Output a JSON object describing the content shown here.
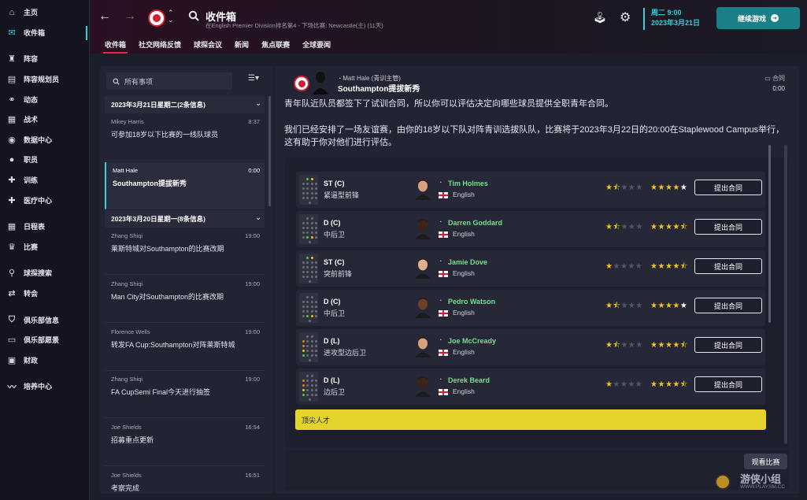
{
  "sidebar": {
    "items": [
      {
        "label": "主页",
        "icon": "home-icon",
        "glyph": "⌂"
      },
      {
        "label": "收件箱",
        "icon": "inbox-icon",
        "glyph": "✉",
        "active": true
      },
      {
        "label": "阵容",
        "icon": "shirt-icon",
        "glyph": "♜"
      },
      {
        "label": "阵容规划员",
        "icon": "clipboard-icon",
        "glyph": "▤"
      },
      {
        "label": "动态",
        "icon": "dynamics-icon",
        "glyph": "⚭"
      },
      {
        "label": "战术",
        "icon": "tactics-icon",
        "glyph": "▦"
      },
      {
        "label": "数据中心",
        "icon": "data-hub-icon",
        "glyph": "◉"
      },
      {
        "label": "职员",
        "icon": "staff-icon",
        "glyph": "●"
      },
      {
        "label": "训练",
        "icon": "training-icon",
        "glyph": "✚"
      },
      {
        "label": "医疗中心",
        "icon": "medical-icon",
        "glyph": "✚"
      },
      {
        "label": "日程表",
        "icon": "calendar-icon",
        "glyph": "▦"
      },
      {
        "label": "比赛",
        "icon": "trophy-icon",
        "glyph": "♛"
      },
      {
        "label": "球探搜索",
        "icon": "scouting-icon",
        "glyph": "⚲"
      },
      {
        "label": "转会",
        "icon": "transfer-icon",
        "glyph": "⇄"
      },
      {
        "label": "俱乐部信息",
        "icon": "club-info-icon",
        "glyph": "⛉"
      },
      {
        "label": "俱乐部愿景",
        "icon": "club-vision-icon",
        "glyph": "▭"
      },
      {
        "label": "财政",
        "icon": "finance-icon",
        "glyph": "▣"
      },
      {
        "label": "培养中心",
        "icon": "development-icon",
        "glyph": "〰"
      }
    ]
  },
  "header": {
    "title": "收件箱",
    "subtitle": "在English Premier Division排名第4 - 下场比赛: Newcastle(主) (11天)",
    "date_line1": "周二 9:00",
    "date_line2": "2023年3月21日",
    "continue_label": "继续游戏",
    "tabs": [
      "收件箱",
      "社交网络反馈",
      "球探会议",
      "新闻",
      "焦点联赛",
      "全球要闻"
    ]
  },
  "inbox": {
    "search_placeholder": "所有事项",
    "groups": [
      {
        "header": "2023年3月21日星期二(2条信息)"
      },
      {
        "header": "2023年3月20日星期一(8条信息)"
      }
    ],
    "messages": [
      {
        "from": "Mikey Harris",
        "time": "8:37",
        "subject": "可参加18岁以下比赛的一线队球员"
      },
      {
        "from": "Matt Hale",
        "time": "0:00",
        "subject": "Southampton提拔新秀"
      },
      {
        "from": "Zhang Shiqi",
        "time": "19:00",
        "subject": "莱斯特城对Southampton的比赛改期"
      },
      {
        "from": "Zhang Shiqi",
        "time": "19:00",
        "subject": "Man City对Southampton的比赛改期"
      },
      {
        "from": "Florence Wells",
        "time": "19:00",
        "subject": "转发FA Cup:Southampton对阵莱斯特城"
      },
      {
        "from": "Zhang Shiqi",
        "time": "19:00",
        "subject": "FA CupSemi Final今天进行抽签"
      },
      {
        "from": "Joe Shields",
        "time": "16:54",
        "subject": "招募重点更新"
      },
      {
        "from": "Joe Shields",
        "time": "16:51",
        "subject": "考察完成"
      }
    ]
  },
  "message": {
    "from": "Matt Hale (青训主管)",
    "subject": "Southampton提拔新秀",
    "contract_label": "合同",
    "contract_time": "0:00",
    "body_top": "青年队近队员都签下了试训合同，所以你可以评估决定向哪些球员提供全职青年合同。",
    "body_main": "我们已经安排了一场友谊赛，由你的18岁以下队对阵青训选拔队队，比赛将于2023年3月22日的20:00在Staplewood Campus举行，这有助于你对他们进行评估。",
    "offer_label": "提出合同",
    "banner": "顶尖人才",
    "view_match": "观看比赛",
    "players": [
      {
        "pos": "ST (C)",
        "role": "紧逼型前锋",
        "name": "Tim Holmes",
        "nationality": "English",
        "current_ability": 1.5,
        "potential_ability": 5
      },
      {
        "pos": "D (C)",
        "role": "中后卫",
        "name": "Darren Goddard",
        "nationality": "English",
        "current_ability": 1.5,
        "potential_ability": 4.5
      },
      {
        "pos": "ST (C)",
        "role": "突前前锋",
        "name": "Jamie Dove",
        "nationality": "English",
        "current_ability": 1,
        "potential_ability": 4.5
      },
      {
        "pos": "D (C)",
        "role": "中后卫",
        "name": "Pedro Watson",
        "nationality": "English",
        "current_ability": 1.5,
        "potential_ability": 5
      },
      {
        "pos": "D (L)",
        "role": "进攻型边后卫",
        "name": "Joe McCready",
        "nationality": "English",
        "current_ability": 1.5,
        "potential_ability": 4.5
      },
      {
        "pos": "D (L)",
        "role": "边后卫",
        "name": "Derek Beard",
        "nationality": "English",
        "current_ability": 1,
        "potential_ability": 4.5
      }
    ]
  },
  "watermark": {
    "big": "游侠小组",
    "small": "WWW.PLAYSM.CC"
  },
  "colors": {
    "accent": "#2fd0d8",
    "club_red": "#d01f32",
    "continue": "#1a7f86",
    "banner": "#e3d32a",
    "star": "#f0c419",
    "player_name": "#6fe08b"
  }
}
